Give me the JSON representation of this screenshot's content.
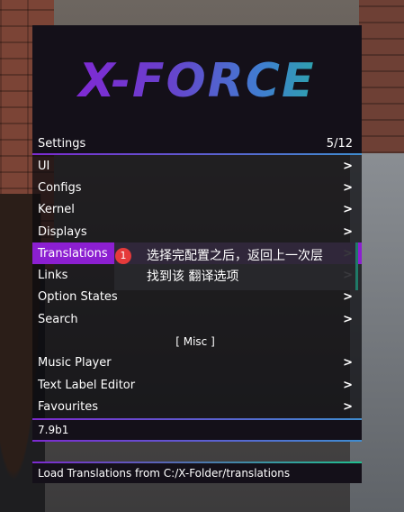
{
  "logo_text": "X-FORCE",
  "subheader": {
    "title": "Settings",
    "page": "5/12"
  },
  "items": [
    {
      "label": "UI",
      "arrow": "›"
    },
    {
      "label": "Configs",
      "arrow": "›"
    },
    {
      "label": "Kernel",
      "arrow": "›"
    },
    {
      "label": "Displays",
      "arrow": "›"
    },
    {
      "label": "Translations",
      "arrow": "›"
    },
    {
      "label": "Links",
      "arrow": "›"
    },
    {
      "label": "Option States",
      "arrow": "›"
    },
    {
      "label": "Search",
      "arrow": "›"
    }
  ],
  "section_label": "[ Misc ]",
  "misc_items": [
    {
      "label": "Music Player",
      "arrow": "›"
    },
    {
      "label": "Text Label Editor",
      "arrow": "›"
    },
    {
      "label": "Favourites",
      "arrow": "›"
    }
  ],
  "version": "7.9b1",
  "description": "Load Translations from C:/X-Folder/translations",
  "tooltip": {
    "badge": "1",
    "line1": "选择完配置之后，返回上一次层",
    "line2": "找到该 翻译选项"
  },
  "colors": {
    "accent": "#8c1fd1",
    "panel": "#141019",
    "badge": "#e53a3a"
  }
}
